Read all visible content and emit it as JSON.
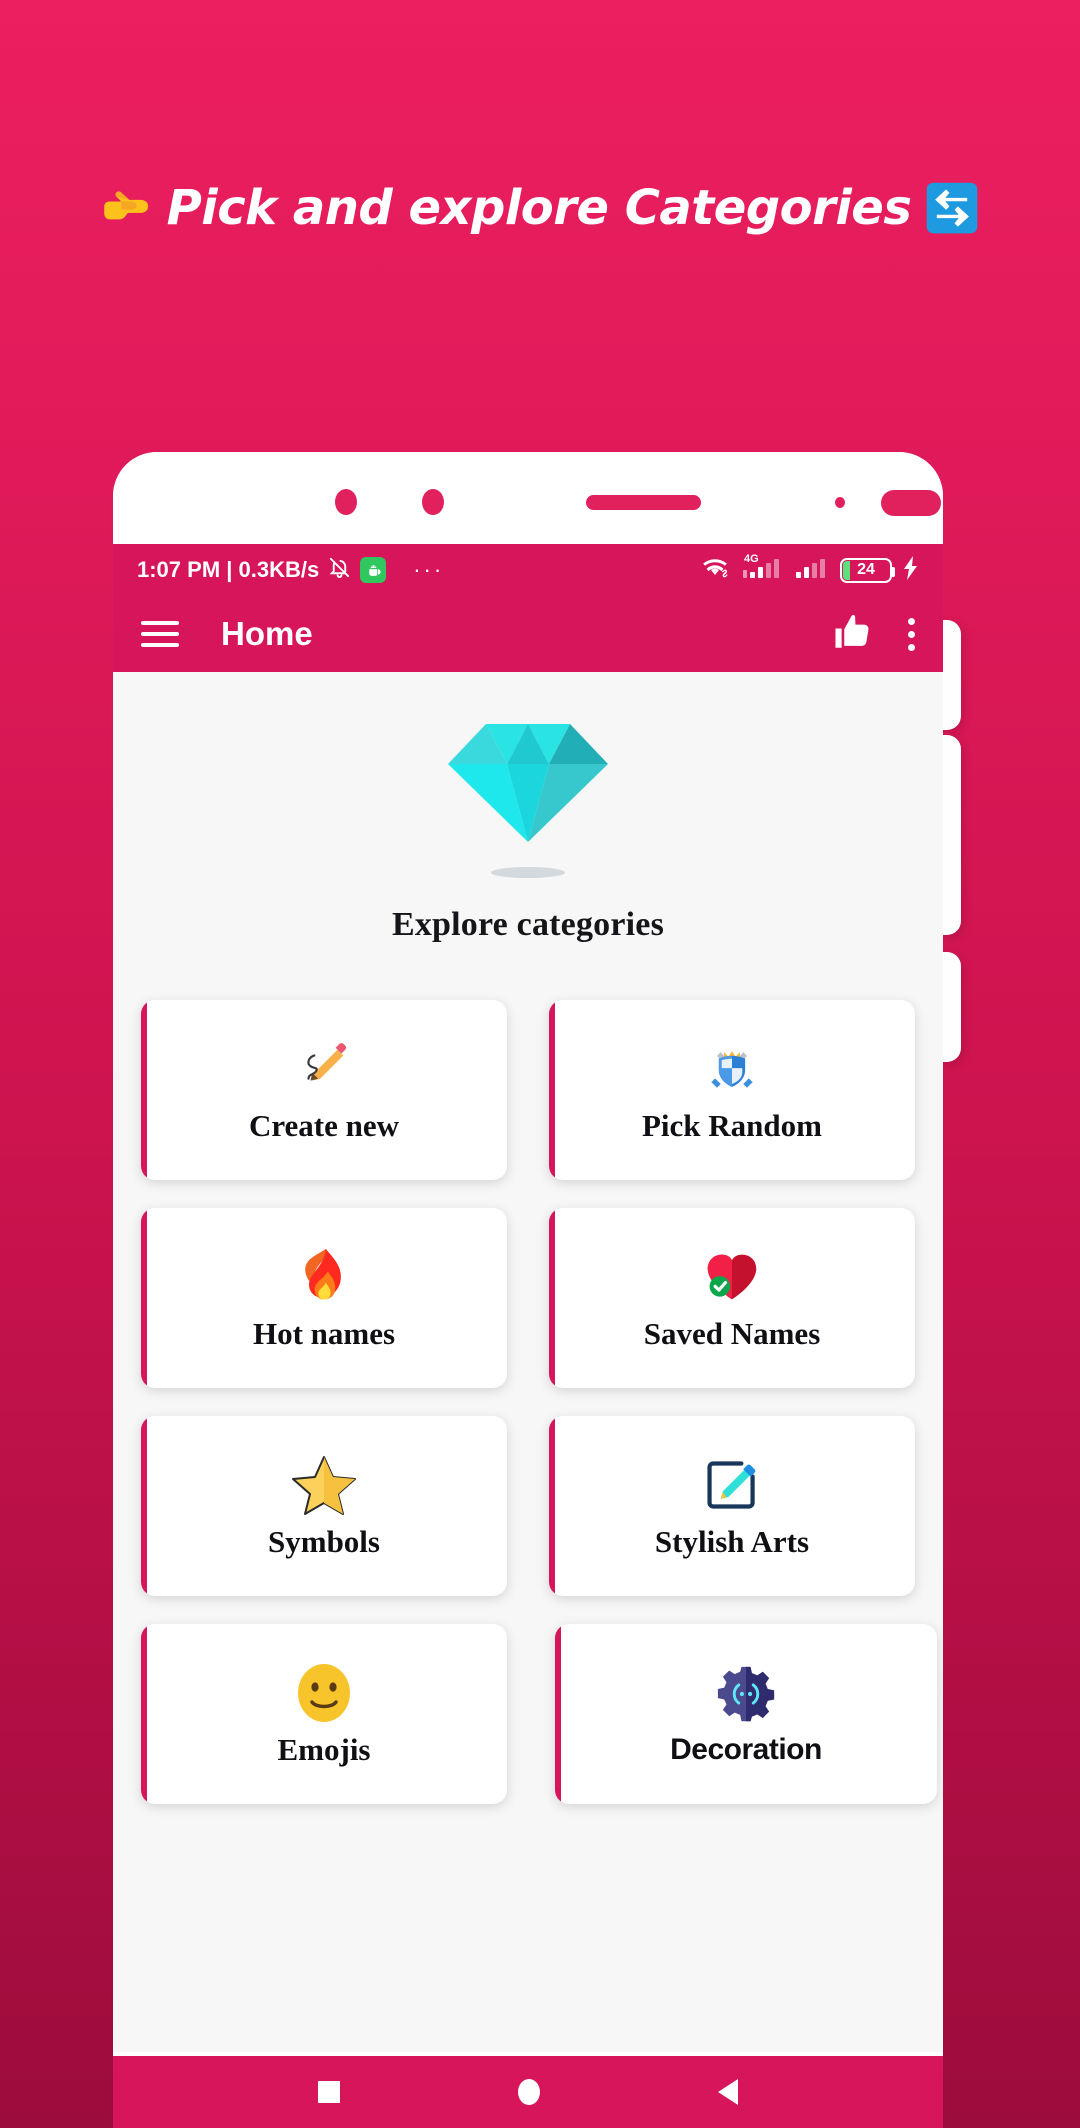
{
  "promo": {
    "headline": "Pick and explore Categories",
    "emoji_left": "pointing-right-hand",
    "emoji_right": "repeat-arrows",
    "background_top": "#ec1f60",
    "background_bottom": "#9c0c3c"
  },
  "phone": {
    "status_bar": {
      "time_and_speed": "1:07 PM | 0.3KB/s",
      "mute_icon": "bell-off-icon",
      "android_icon": "android-head-icon",
      "more_dots": "···",
      "wifi_icon": "wifi-icon",
      "network_label": "4G",
      "signal_icon": "signal-bars-icon",
      "signal2_icon": "signal-bars-icon",
      "battery_percent": "24",
      "charging_icon": "lightning-bolt-icon",
      "bar_color": "#d6155a"
    },
    "app_bar": {
      "menu_icon": "hamburger-menu-icon",
      "title": "Home",
      "like_icon": "thumbs-up-icon",
      "overflow_icon": "three-dot-overflow-icon",
      "color": "#d6155a"
    },
    "hero": {
      "image": "diamond-icon",
      "title": "Explore categories"
    },
    "categories": [
      {
        "label": "Create new",
        "icon": "writing-hand-pencil-icon",
        "font": "serif"
      },
      {
        "label": "Pick Random",
        "icon": "crest-shield-swords-icon",
        "font": "serif"
      },
      {
        "label": "Hot names",
        "icon": "fire-icon",
        "font": "serif"
      },
      {
        "label": "Saved Names",
        "icon": "heart-check-icon",
        "font": "serif"
      },
      {
        "label": "Symbols",
        "icon": "star-icon",
        "font": "serif"
      },
      {
        "label": "Stylish Arts",
        "icon": "note-pencil-icon",
        "font": "serif"
      },
      {
        "label": "Emojis",
        "icon": "smiley-face-icon",
        "font": "serif"
      },
      {
        "label": "Decoration",
        "icon": "gear-code-icon",
        "font": "sans"
      }
    ],
    "nav_bar": {
      "recents_icon": "square-recents-icon",
      "home_icon": "circle-home-icon",
      "back_icon": "triangle-back-icon",
      "color": "#d6155a"
    },
    "accent_color": "#d6155a",
    "screen_bg": "#f7f7f8"
  }
}
